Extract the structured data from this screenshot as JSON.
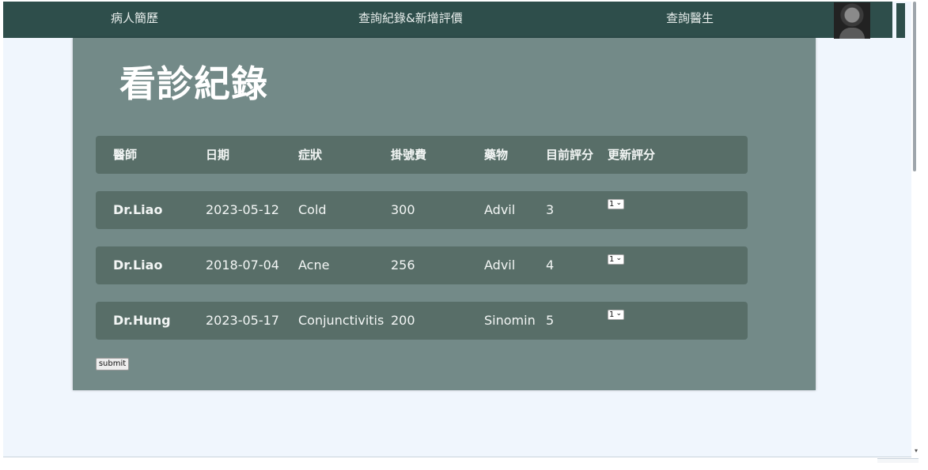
{
  "nav": {
    "items": [
      "病人簡歷",
      "查詢紀錄&新增評價",
      "查詢醫生"
    ]
  },
  "page": {
    "title": "看診紀錄"
  },
  "table": {
    "columns": [
      "醫師",
      "日期",
      "症狀",
      "掛號費",
      "藥物",
      "目前評分",
      "更新評分"
    ],
    "rows": [
      {
        "doctor": "Dr.Liao",
        "date": "2023-05-12",
        "symptom": "Cold",
        "fee": "300",
        "medicine": "Advil",
        "rating": "3",
        "new_rating": "1"
      },
      {
        "doctor": "Dr.Liao",
        "date": "2018-07-04",
        "symptom": "Acne",
        "fee": "256",
        "medicine": "Advil",
        "rating": "4",
        "new_rating": "1"
      },
      {
        "doctor": "Dr.Hung",
        "date": "2023-05-17",
        "symptom": "Conjunctivitis",
        "fee": "200",
        "medicine": "Sinomin",
        "rating": "5",
        "new_rating": "1"
      }
    ]
  },
  "form": {
    "submit_label": "submit"
  },
  "icons": {
    "avatar": "user-avatar-photo",
    "select_chevron": "chevron-down-icon"
  },
  "colors": {
    "navbar": "#2e4e4b",
    "panel": "#738a88",
    "row": "#586e68",
    "background": "#f0f6fd"
  }
}
